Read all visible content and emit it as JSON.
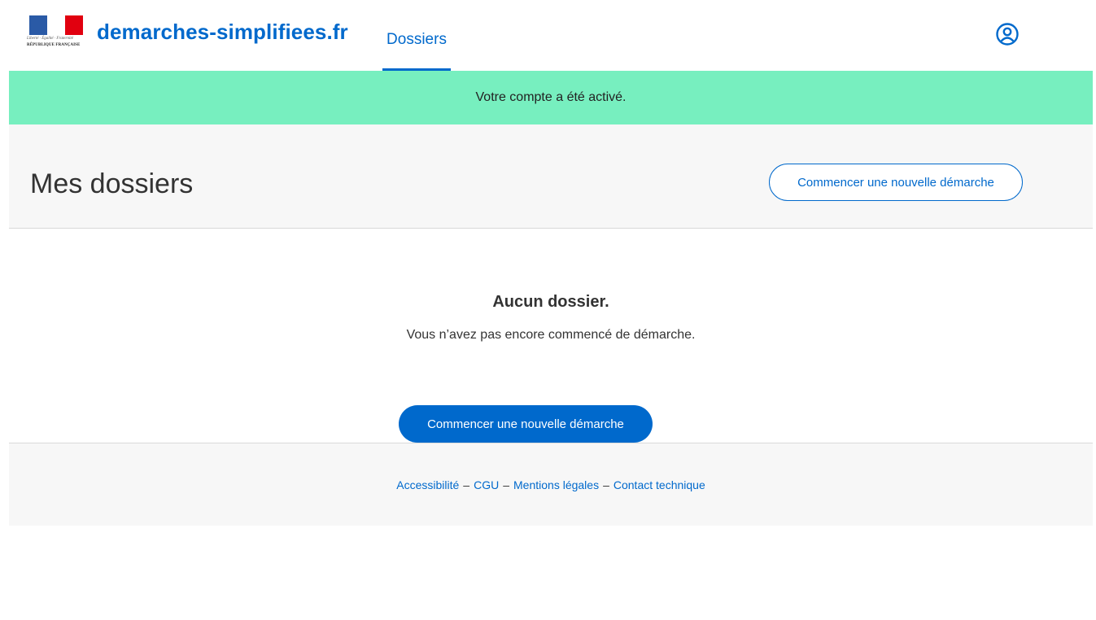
{
  "header": {
    "logo_motto": "Liberté · Égalité · Fraternité",
    "logo_republic": "RÉPUBLIQUE FRANÇAISE",
    "site_name": "demarches-simplifiees.fr",
    "nav_tab": "Dossiers",
    "user_icon": "user-circle-icon"
  },
  "flash": {
    "message": "Votre compte a été activé."
  },
  "title_band": {
    "title": "Mes dossiers",
    "new_button": "Commencer une nouvelle démarche"
  },
  "empty_state": {
    "title": "Aucun dossier.",
    "text": "Vous n’avez pas encore commencé de démarche.",
    "button": "Commencer une nouvelle démarche"
  },
  "footer": {
    "links": [
      "Accessibilité",
      "CGU",
      "Mentions légales",
      "Contact technique"
    ],
    "separator": "–"
  },
  "colors": {
    "brand_blue": "#0069cc",
    "flash_green": "#77efbf",
    "band_grey": "#f7f7f7"
  }
}
